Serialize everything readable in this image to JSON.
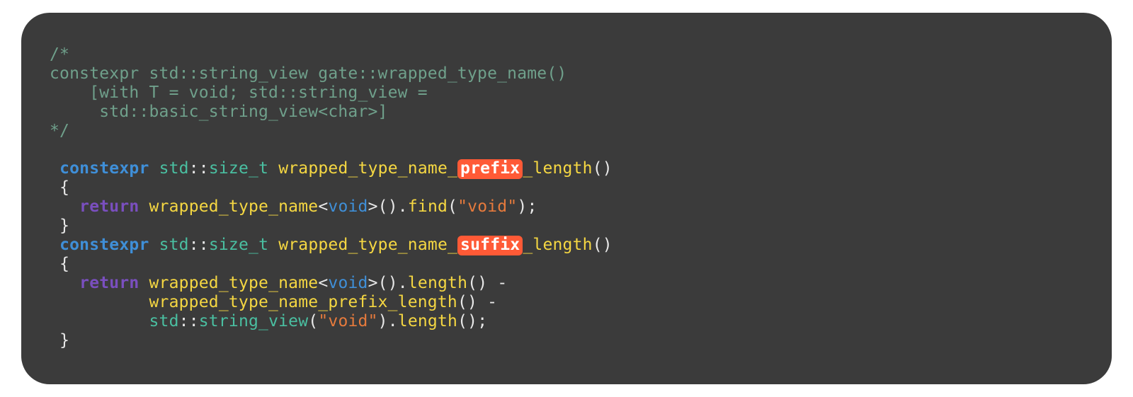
{
  "comment": {
    "open": "/*",
    "l1": "constexpr std::string_view gate::wrapped_type_name()",
    "l2": "    [with T = void; std::string_view =",
    "l3": "     std::basic_string_view<char>]",
    "close": "*/"
  },
  "kw": {
    "constexpr": "constexpr",
    "return": "return",
    "void": "void"
  },
  "ns": {
    "std": "std"
  },
  "punc": {
    "coloncolon": "::",
    "lbrace": "{",
    "rbrace": "}",
    "lparen": "(",
    "rparen": ")",
    "lt": "<",
    "gt": ">",
    "dot": ".",
    "semi": ";",
    "minus": " -",
    "usc": "_"
  },
  "types": {
    "size_t": "size_t",
    "string_view": "string_view"
  },
  "funcs": {
    "wrapped_type_name": "wrapped_type_name",
    "prefix_fn_prefix": "wrapped_type_name_",
    "suffix_fn_prefix": "wrapped_type_name_",
    "length_word": "length",
    "find": "find",
    "length": "length",
    "wtn_prefix_len": "wrapped_type_name_prefix_length"
  },
  "hl": {
    "prefix": "prefix",
    "suffix": "suffix"
  },
  "str": {
    "void": "\"void\""
  }
}
